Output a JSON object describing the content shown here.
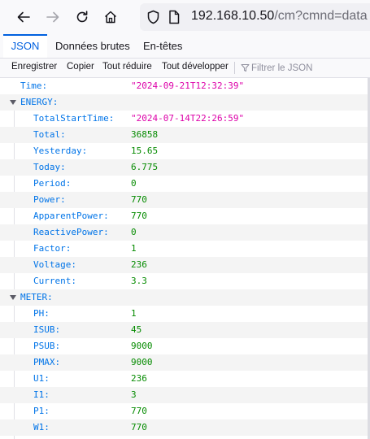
{
  "browser": {
    "url_host": "192.168.10.50",
    "url_path": "/cm?cmnd=data",
    "icons": [
      "back-arrow-icon",
      "forward-arrow-icon",
      "reload-icon",
      "home-icon",
      "shield-icon",
      "page-icon"
    ]
  },
  "viewer": {
    "tabs": [
      {
        "label": "JSON",
        "active": true
      },
      {
        "label": "Données brutes",
        "active": false
      },
      {
        "label": "En-têtes",
        "active": false
      }
    ],
    "toolbar": {
      "save": "Enregistrer",
      "copy": "Copier",
      "collapse_all": "Tout réduire",
      "expand_all": "Tout développer",
      "filter_placeholder": "Filtrer le JSON"
    },
    "accent_color": "#0060df"
  },
  "json": {
    "time": {
      "key": "Time:",
      "value": "\"2024-09-21T12:32:39\""
    },
    "energy": {
      "key": "ENERGY:",
      "items": [
        {
          "key": "TotalStartTime:",
          "value": "\"2024-07-14T22:26:59\"",
          "type": "string"
        },
        {
          "key": "Total:",
          "value": "36858",
          "type": "number"
        },
        {
          "key": "Yesterday:",
          "value": "15.65",
          "type": "number"
        },
        {
          "key": "Today:",
          "value": "6.775",
          "type": "number"
        },
        {
          "key": "Period:",
          "value": "0",
          "type": "number"
        },
        {
          "key": "Power:",
          "value": "770",
          "type": "number"
        },
        {
          "key": "ApparentPower:",
          "value": "770",
          "type": "number"
        },
        {
          "key": "ReactivePower:",
          "value": "0",
          "type": "number"
        },
        {
          "key": "Factor:",
          "value": "1",
          "type": "number"
        },
        {
          "key": "Voltage:",
          "value": "236",
          "type": "number"
        },
        {
          "key": "Current:",
          "value": "3.3",
          "type": "number"
        }
      ]
    },
    "meter": {
      "key": "METER:",
      "items": [
        {
          "key": "PH:",
          "value": "1",
          "type": "number"
        },
        {
          "key": "ISUB:",
          "value": "45",
          "type": "number"
        },
        {
          "key": "PSUB:",
          "value": "9000",
          "type": "number"
        },
        {
          "key": "PMAX:",
          "value": "9000",
          "type": "number"
        },
        {
          "key": "U1:",
          "value": "236",
          "type": "number"
        },
        {
          "key": "I1:",
          "value": "3",
          "type": "number"
        },
        {
          "key": "P1:",
          "value": "770",
          "type": "number"
        },
        {
          "key": "W1:",
          "value": "770",
          "type": "number"
        }
      ]
    }
  }
}
